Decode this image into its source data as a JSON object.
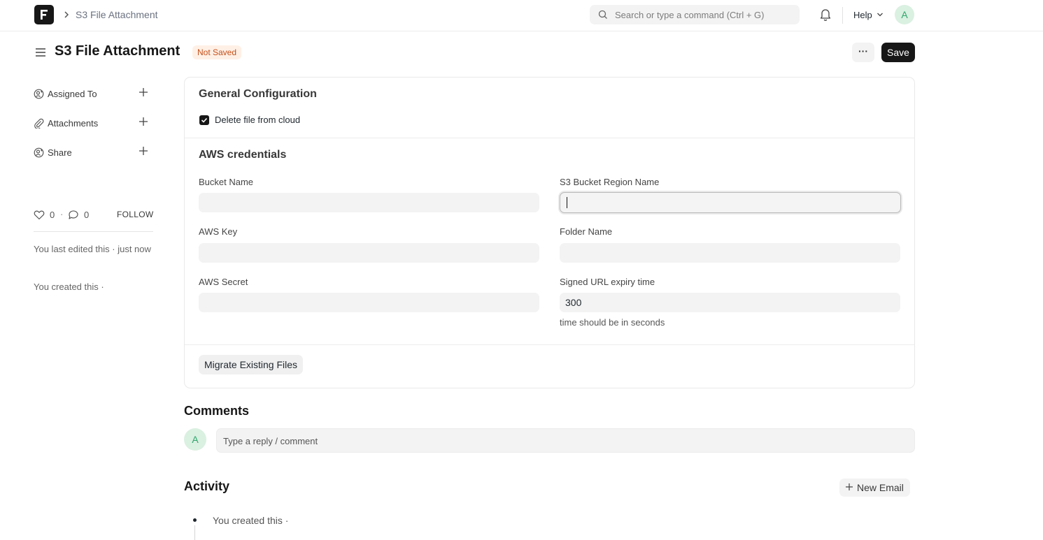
{
  "navbar": {
    "breadcrumb": "S3 File Attachment",
    "search_placeholder": "Search or type a command (Ctrl + G)",
    "help_label": "Help",
    "avatar_initial": "A"
  },
  "page": {
    "title": "S3 File Attachment",
    "status": "Not Saved",
    "more_label": "···",
    "save_label": "Save"
  },
  "sidebar": {
    "items": [
      {
        "label": "Assigned To",
        "icon": "assign-icon"
      },
      {
        "label": "Attachments",
        "icon": "paperclip-icon"
      },
      {
        "label": "Share",
        "icon": "share-icon"
      }
    ],
    "likes_count": "0",
    "comments_count": "0",
    "separator": "·",
    "follow_label": "FOLLOW",
    "last_edited": "You last edited this · just now",
    "created": "You created this ·"
  },
  "form": {
    "general_section": "General Configuration",
    "delete_file_label": "Delete file from cloud",
    "delete_file_checked": true,
    "aws_section": "AWS credentials",
    "fields": {
      "bucket_name": {
        "label": "Bucket Name",
        "value": ""
      },
      "region_name": {
        "label": "S3 Bucket Region Name",
        "value": ""
      },
      "aws_key": {
        "label": "AWS Key",
        "value": ""
      },
      "folder_name": {
        "label": "Folder Name",
        "value": ""
      },
      "aws_secret": {
        "label": "AWS Secret",
        "value": ""
      },
      "expiry_time": {
        "label": "Signed URL expiry time",
        "value": "300",
        "help": "time should be in seconds"
      }
    },
    "migrate_label": "Migrate Existing Files"
  },
  "comments": {
    "title": "Comments",
    "avatar_initial": "A",
    "placeholder": "Type a reply / comment"
  },
  "activity": {
    "title": "Activity",
    "new_email_label": "New Email",
    "timeline_entry": "You created this ·"
  }
}
